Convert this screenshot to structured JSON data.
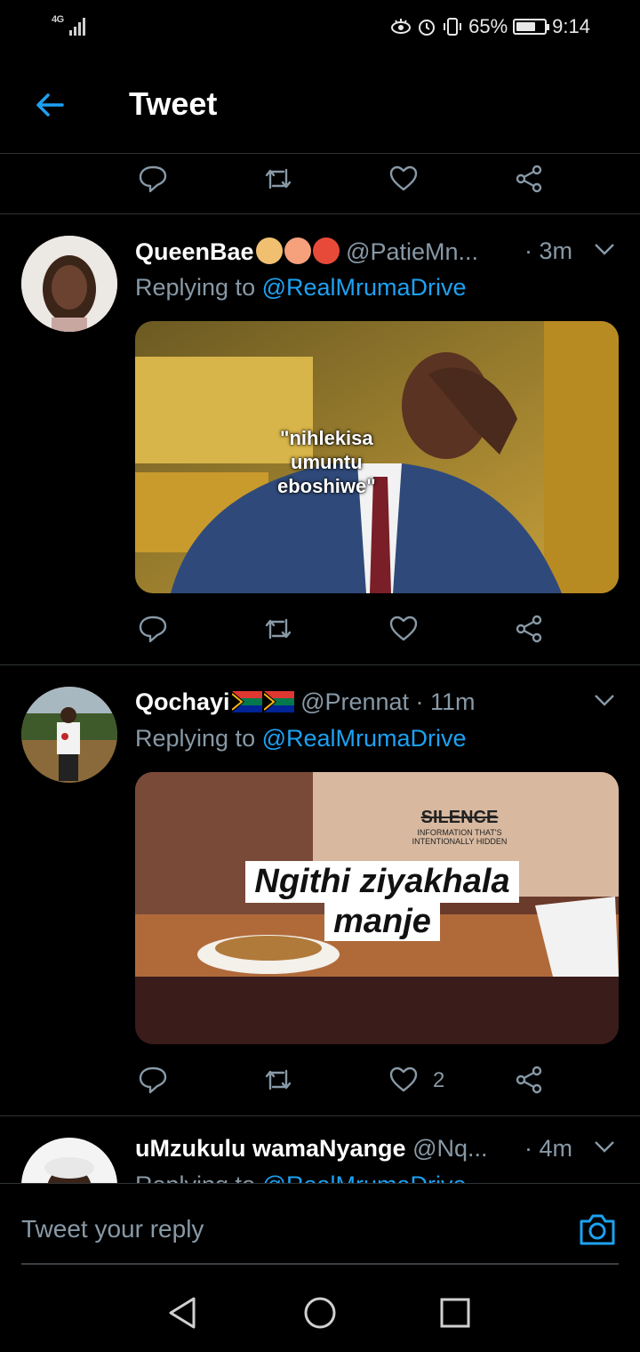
{
  "status_bar": {
    "network": "4G",
    "battery": "65%",
    "time": "9:14"
  },
  "header": {
    "title": "Tweet"
  },
  "tweets": [
    {
      "display_name": "QueenBae",
      "handle": "@PatieMn...",
      "time": "· 3m",
      "replying_prefix": "Replying to",
      "replying_to": "@RealMrumaDrive",
      "image_caption": [
        "\"nihlekisa",
        "umuntu",
        "eboshiwe\""
      ]
    },
    {
      "display_name": "Qochayi",
      "handle": "@Prennat · 11m",
      "time": "",
      "replying_prefix": "Replying to",
      "replying_to": "@RealMrumaDrive",
      "image_caption": [
        "Ngithi ziyakhala",
        "manje"
      ],
      "shirt_text": [
        "SILENCE",
        "INFORMATION THAT'S",
        "INTENTIONALLY HIDDEN"
      ],
      "like_count": "2"
    },
    {
      "display_name": "uMzukulu wamaNyange",
      "handle": "@Nq...",
      "time": "· 4m",
      "replying_prefix": "Replying to",
      "replying_to": "@RealMrumaDrive"
    }
  ],
  "reply_bar": {
    "placeholder": "Tweet your reply"
  },
  "icons": {
    "reply": "reply-icon",
    "retweet": "retweet-icon",
    "like": "heart-icon",
    "share": "share-icon",
    "camera": "camera-icon",
    "back": "back-arrow-icon"
  },
  "colors": {
    "accent": "#1da1f2",
    "muted": "#8899a6",
    "divider": "#2f3336"
  }
}
